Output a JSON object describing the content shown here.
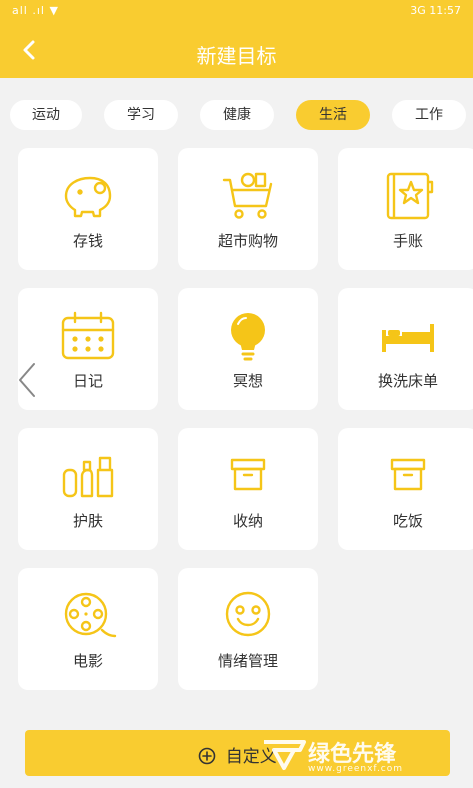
{
  "status": {
    "left": "all .ıl ▼",
    "right": "3G 11:57"
  },
  "header": {
    "title": "新建目标",
    "back_icon": "chevron-left-icon"
  },
  "tabs": [
    {
      "label": "运动",
      "active": false
    },
    {
      "label": "学习",
      "active": false
    },
    {
      "label": "健康",
      "active": false
    },
    {
      "label": "生活",
      "active": true
    },
    {
      "label": "工作",
      "active": false
    }
  ],
  "cards": [
    {
      "label": "存钱",
      "icon": "piggy-bank-icon"
    },
    {
      "label": "超市购物",
      "icon": "shopping-cart-icon"
    },
    {
      "label": "手账",
      "icon": "notebook-icon"
    },
    {
      "label": "日记",
      "icon": "calendar-icon"
    },
    {
      "label": "冥想",
      "icon": "lightbulb-icon"
    },
    {
      "label": "换洗床单",
      "icon": "bed-icon"
    },
    {
      "label": "护肤",
      "icon": "skincare-bottles-icon"
    },
    {
      "label": "收纳",
      "icon": "storage-box-icon"
    },
    {
      "label": "吃饭",
      "icon": "food-box-icon"
    },
    {
      "label": "电影",
      "icon": "film-reel-icon"
    },
    {
      "label": "情绪管理",
      "icon": "smiley-face-icon"
    }
  ],
  "bottom": {
    "label": "自定义",
    "icon": "plus-circle-icon"
  },
  "watermark": {
    "text": "绿色先锋",
    "url": "www.greenxf.com"
  },
  "colors": {
    "accent": "#f9cc30",
    "icon": "#f5c518"
  }
}
